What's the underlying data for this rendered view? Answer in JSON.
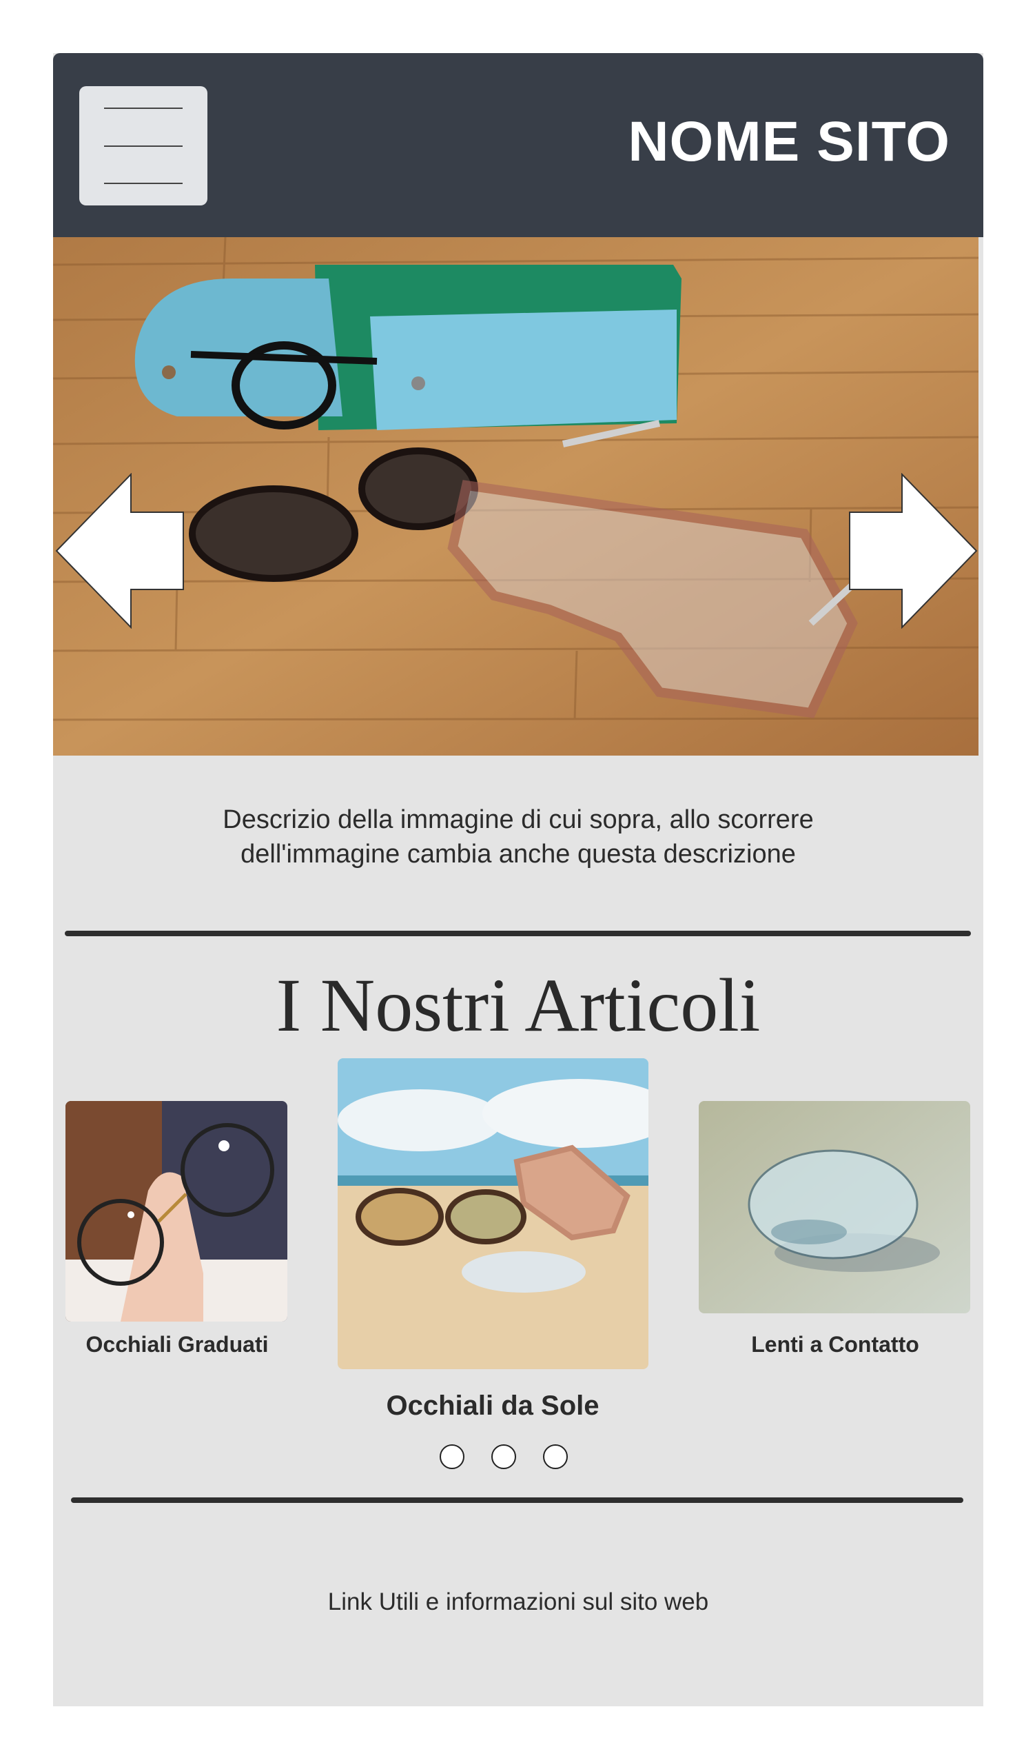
{
  "header": {
    "site_title": "NOME SITO",
    "menu_icon": "hamburger-menu-icon",
    "background_color": "#383e48"
  },
  "hero": {
    "image": "glasses-on-wooden-table-with-case",
    "prev_icon": "arrow-left-icon",
    "next_icon": "arrow-right-icon",
    "description_line1": "Descrizio della immagine di cui sopra, allo scorrere",
    "description_line2": "dell'immagine cambia anche questa descrizione"
  },
  "articles": {
    "title": "I Nostri Articoli",
    "items": [
      {
        "label": "Occhiali Graduati",
        "image": "hand-holding-eyeglasses"
      },
      {
        "label": "Occhiali da Sole",
        "image": "sunglasses-on-beach"
      },
      {
        "label": "Lenti a Contatto",
        "image": "contact-lens"
      }
    ],
    "pagination_dots": 3
  },
  "footer": {
    "link_text": "Link Utili e informazioni sul sito web"
  }
}
